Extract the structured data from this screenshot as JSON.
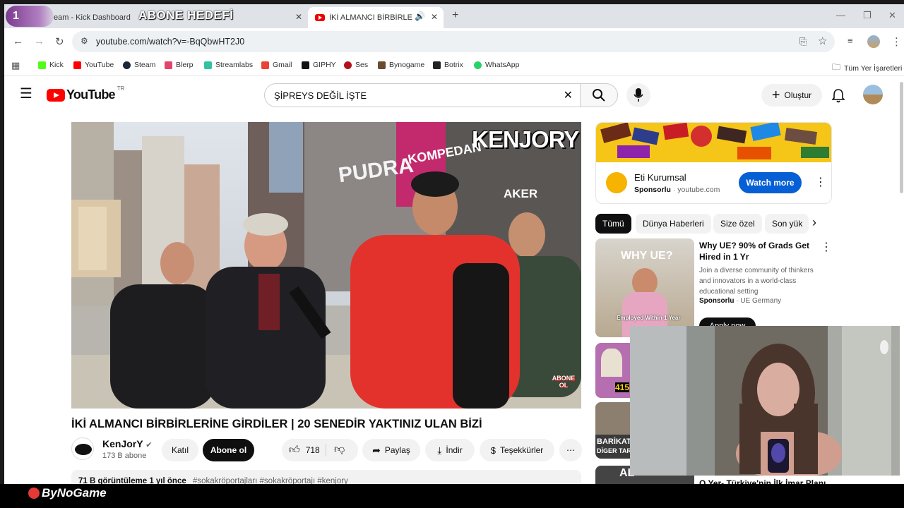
{
  "browser": {
    "tabs": [
      {
        "label": "eam - Kick Dashboard"
      },
      {
        "label": "İKİ ALMANCI BİRBİRLERİNE"
      }
    ],
    "overlay_badge": "1",
    "overlay_title": "ABONE HEDEFİ",
    "url": "youtube.com/watch?v=-BqQbwHT2J0"
  },
  "bookmarks": [
    {
      "label": "Kick",
      "color": "#53fc18"
    },
    {
      "label": "YouTube",
      "color": "#ff0000"
    },
    {
      "label": "Steam",
      "color": "#1b2838"
    },
    {
      "label": "Blerp",
      "color": "#e2446c"
    },
    {
      "label": "Streamlabs",
      "color": "#31c3a2"
    },
    {
      "label": "Gmail",
      "color": "#ea4335"
    },
    {
      "label": "GIPHY",
      "color": "#121212"
    },
    {
      "label": "Ses",
      "color": "#b3121a"
    },
    {
      "label": "Bynogame",
      "color": "#6b4b2e"
    },
    {
      "label": "Botrix",
      "color": "#222222"
    },
    {
      "label": "WhatsApp",
      "color": "#25d366"
    }
  ],
  "bookmarks_all": "Tüm Yer İşaretleri",
  "youtube": {
    "logo": "YouTube",
    "country": "TR",
    "search_value": "ŞİPREYS DEĞİL İŞTE",
    "create_label": "Oluştur"
  },
  "video": {
    "watermark": "KENJORY",
    "shop_sign": "PUDRA",
    "shop_sign2": "KOMPEDAN",
    "shop_sign3": "AKER",
    "subscribe_badge": "ABONE OL",
    "title": "İKİ ALMANCI BİRBİRLERİNE GİRDİLER | 20 SENEDİR YAKTINIZ ULAN BİZİ",
    "channel_name": "KenJorY",
    "subscribers": "173 B abone",
    "join_label": "Katıl",
    "subscribe_label": "Abone ol",
    "likes": "718",
    "share_label": "Paylaş",
    "download_label": "İndir",
    "thanks_label": "Teşekkürler",
    "description_meta": "71 B görüntüleme  1 yıl önce",
    "hashtags": "#sokakröportajları #sokakröportajı #kenjory"
  },
  "ad": {
    "advertiser": "Eti Kurumsal",
    "sponsored": "Sponsorlu",
    "domain": "youtube.com",
    "cta": "Watch more"
  },
  "chips": [
    "Tümü",
    "Dünya Haberleri",
    "Size özel",
    "Son yük"
  ],
  "recommendations": [
    {
      "title": "Why UE? 90% of Grads Get Hired in 1 Yr",
      "description": "Join a diverse community of thinkers and innovators in a world-class educational setting",
      "sponsored": "Sponsorlu",
      "advertiser": "UE Germany",
      "thumb_heading": "WHY UE?",
      "thumb_caption": "Employed Within 1 Year",
      "cta": "Apply now"
    }
  ],
  "partial_texts": {
    "thumb2_badge": "415",
    "thumb3_label": "BARİKAT",
    "thumb3_label2": "DİGER TAR",
    "thumb4_label": "AL",
    "rec_bottom_title": "O Yer- Türkiye'nin İlk İmar Planı"
  },
  "taskbar": {
    "brand": "ByNoGame"
  }
}
